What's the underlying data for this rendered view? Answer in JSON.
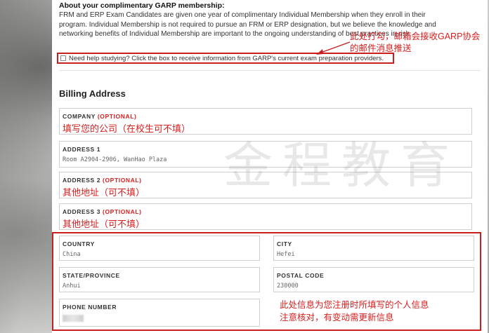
{
  "membership": {
    "title": "About your complimentary GARP membership:",
    "body": "FRM and ERP Exam Candidates are given one year of complimentary Individual Membership when they enroll in their program. Individual Membership is not required to pursue an FRM or ERP designation, but we believe the knowledge and networking benefits of Individual Membership are important to the ongoing understanding of best practices in risk."
  },
  "study_checkbox": {
    "checked": false,
    "label": "Need help studying? Click the box to receive information from GARP's current exam preparation providers."
  },
  "annotations": {
    "checkbox_note": "此处打勾，邮箱会接收GARP协会的邮件消息推送",
    "personal_info_line1": "此处信息为您注册时所填写的个人信息",
    "personal_info_line2": "注意核对，有变动需更新信息",
    "annotation_color": "#d62020"
  },
  "billing": {
    "section_title": "Billing Address",
    "optional_text": "(OPTIONAL)",
    "company": {
      "label": "COMPANY",
      "note": "填写您的公司（在校生可不填）"
    },
    "address1": {
      "label": "ADDRESS 1",
      "value": "Room A2904-2906, WanHao Plaza"
    },
    "address2": {
      "label": "ADDRESS 2",
      "note": "其他地址（可不填）"
    },
    "address3": {
      "label": "ADDRESS 3",
      "note": "其他地址（可不填）"
    },
    "country": {
      "label": "COUNTRY",
      "value": "China"
    },
    "city": {
      "label": "CITY",
      "value": "Hefei"
    },
    "state": {
      "label": "STATE/PROVINCE",
      "value": "Anhui"
    },
    "postal_code": {
      "label": "POSTAL CODE",
      "value": "230000"
    },
    "phone": {
      "label": "PHONE NUMBER",
      "value_redacted": true
    }
  },
  "watermark": "金程教育"
}
